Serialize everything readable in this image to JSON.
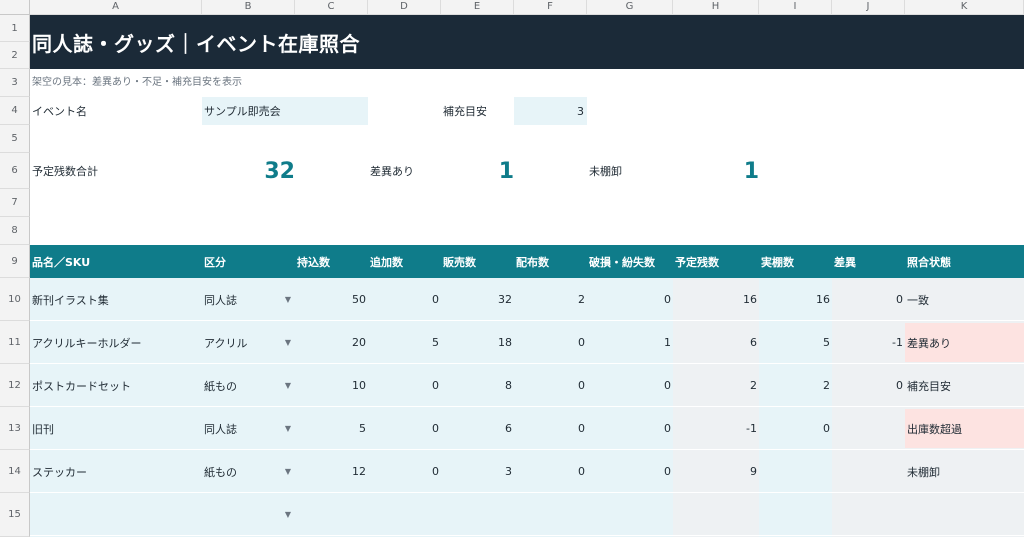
{
  "columns": [
    "A",
    "B",
    "C",
    "D",
    "E",
    "F",
    "G",
    "H",
    "I",
    "J",
    "K"
  ],
  "rows": [
    "1",
    "2",
    "3",
    "4",
    "5",
    "6",
    "7",
    "8",
    "9",
    "10",
    "11",
    "12",
    "13",
    "14",
    "15"
  ],
  "title": "同人誌・グッズ｜イベント在庫照合",
  "note": "架空の見本：差異あり・不足・補充目安を表示",
  "event": {
    "label": "イベント名",
    "value": "サンプル即売会"
  },
  "restock": {
    "label": "補充目安",
    "value": "3"
  },
  "summary": {
    "remaining_label": "予定残数合計",
    "remaining_value": "32",
    "diff_label": "差異あり",
    "diff_value": "1",
    "uncounted_label": "未棚卸",
    "uncounted_value": "1"
  },
  "table_headers": [
    "品名／SKU",
    "区分",
    "持込数",
    "追加数",
    "販売数",
    "配布数",
    "破損・紛失数",
    "予定残数",
    "実棚数",
    "差異",
    "照合状態"
  ],
  "dropdown_glyph": "▼",
  "items": [
    {
      "name": "新刊イラスト集",
      "category": "同人誌",
      "brought": "50",
      "added": "0",
      "sold": "32",
      "distributed": "2",
      "lost": "0",
      "planned": "16",
      "actual": "16",
      "diff": "0",
      "status": "一致",
      "status_flag": "normal"
    },
    {
      "name": "アクリルキーホルダー",
      "category": "アクリル",
      "brought": "20",
      "added": "5",
      "sold": "18",
      "distributed": "0",
      "lost": "1",
      "planned": "6",
      "actual": "5",
      "diff": "-1",
      "status": "差異あり",
      "status_flag": "alert"
    },
    {
      "name": "ポストカードセット",
      "category": "紙もの",
      "brought": "10",
      "added": "0",
      "sold": "8",
      "distributed": "0",
      "lost": "0",
      "planned": "2",
      "actual": "2",
      "diff": "0",
      "status": "補充目安",
      "status_flag": "normal"
    },
    {
      "name": "旧刊",
      "category": "同人誌",
      "brought": "5",
      "added": "0",
      "sold": "6",
      "distributed": "0",
      "lost": "0",
      "planned": "-1",
      "actual": "0",
      "diff": "",
      "status": "出庫数超過",
      "status_flag": "alert"
    },
    {
      "name": "ステッカー",
      "category": "紙もの",
      "brought": "12",
      "added": "0",
      "sold": "3",
      "distributed": "0",
      "lost": "0",
      "planned": "9",
      "actual": "",
      "diff": "",
      "status": "未棚卸",
      "status_flag": "normal"
    },
    {
      "name": "",
      "category": "",
      "brought": "",
      "added": "",
      "sold": "",
      "distributed": "",
      "lost": "",
      "planned": "",
      "actual": "",
      "diff": "",
      "status": "",
      "status_flag": "normal"
    }
  ],
  "colors": {
    "title_bg": "#1b2a38",
    "accent": "#0f7c8a",
    "input_bg": "#e7f4f8",
    "calc_bg": "#eef1f3",
    "alert_bg": "#fde3e1"
  }
}
